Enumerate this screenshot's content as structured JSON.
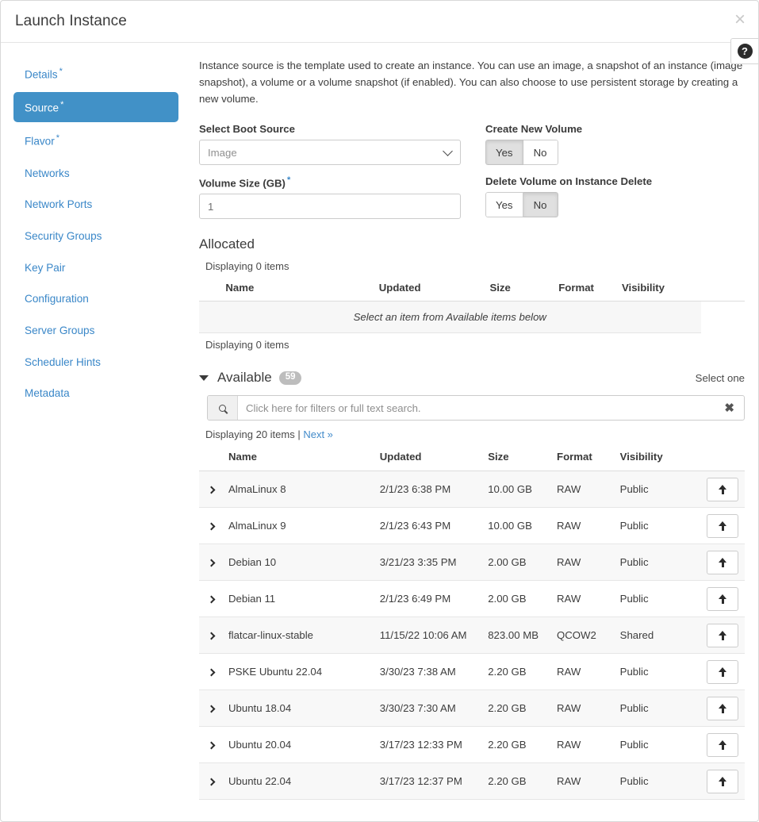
{
  "header": {
    "title": "Launch Instance",
    "close_label": "×",
    "help_label": "?"
  },
  "sidebar": {
    "items": [
      {
        "label": "Details",
        "required": true,
        "active": false
      },
      {
        "label": "Source",
        "required": true,
        "active": true
      },
      {
        "label": "Flavor",
        "required": true,
        "active": false
      },
      {
        "label": "Networks",
        "required": false,
        "active": false
      },
      {
        "label": "Network Ports",
        "required": false,
        "active": false
      },
      {
        "label": "Security Groups",
        "required": false,
        "active": false
      },
      {
        "label": "Key Pair",
        "required": false,
        "active": false
      },
      {
        "label": "Configuration",
        "required": false,
        "active": false
      },
      {
        "label": "Server Groups",
        "required": false,
        "active": false
      },
      {
        "label": "Scheduler Hints",
        "required": false,
        "active": false
      },
      {
        "label": "Metadata",
        "required": false,
        "active": false
      }
    ]
  },
  "main": {
    "description": "Instance source is the template used to create an instance. You can use an image, a snapshot of an instance (image snapshot), a volume or a volume snapshot (if enabled). You can also choose to use persistent storage by creating a new volume.",
    "boot_source": {
      "label": "Select Boot Source",
      "value": "Image"
    },
    "volume_size": {
      "label": "Volume Size (GB)",
      "value": "1",
      "required": true
    },
    "create_new_volume": {
      "label": "Create New Volume",
      "yes_label": "Yes",
      "no_label": "No",
      "selected": "Yes"
    },
    "delete_volume": {
      "label": "Delete Volume on Instance Delete",
      "yes_label": "Yes",
      "no_label": "No",
      "selected": "No"
    },
    "allocated": {
      "title": "Allocated",
      "count_top": "Displaying 0 items",
      "count_bottom": "Displaying 0 items",
      "columns": [
        "Name",
        "Updated",
        "Size",
        "Format",
        "Visibility"
      ],
      "empty_message": "Select an item from Available items below"
    },
    "available": {
      "title": "Available",
      "badge": "59",
      "select_hint": "Select one",
      "search_placeholder": "Click here for filters or full text search.",
      "search_value": "",
      "clear_label": "✖",
      "count_text": "Displaying 20 items |",
      "next_label": "Next »",
      "columns": [
        "Name",
        "Updated",
        "Size",
        "Format",
        "Visibility"
      ],
      "rows": [
        {
          "name": "AlmaLinux 8",
          "updated": "2/1/23 6:38 PM",
          "size": "10.00 GB",
          "format": "RAW",
          "visibility": "Public"
        },
        {
          "name": "AlmaLinux 9",
          "updated": "2/1/23 6:43 PM",
          "size": "10.00 GB",
          "format": "RAW",
          "visibility": "Public"
        },
        {
          "name": "Debian 10",
          "updated": "3/21/23 3:35 PM",
          "size": "2.00 GB",
          "format": "RAW",
          "visibility": "Public"
        },
        {
          "name": "Debian 11",
          "updated": "2/1/23 6:49 PM",
          "size": "2.00 GB",
          "format": "RAW",
          "visibility": "Public"
        },
        {
          "name": "flatcar-linux-stable",
          "updated": "11/15/22 10:06 AM",
          "size": "823.00 MB",
          "format": "QCOW2",
          "visibility": "Shared"
        },
        {
          "name": "PSKE Ubuntu 22.04",
          "updated": "3/30/23 7:38 AM",
          "size": "2.20 GB",
          "format": "RAW",
          "visibility": "Public"
        },
        {
          "name": "Ubuntu 18.04",
          "updated": "3/30/23 7:30 AM",
          "size": "2.20 GB",
          "format": "RAW",
          "visibility": "Public"
        },
        {
          "name": "Ubuntu 20.04",
          "updated": "3/17/23 12:33 PM",
          "size": "2.20 GB",
          "format": "RAW",
          "visibility": "Public"
        },
        {
          "name": "Ubuntu 22.04",
          "updated": "3/17/23 12:37 PM",
          "size": "2.20 GB",
          "format": "RAW",
          "visibility": "Public"
        }
      ]
    }
  },
  "colors": {
    "accent": "#4191c7",
    "link": "#3a87c8",
    "badge": "#bdbdbd",
    "row_alt": "#f8f8f8"
  }
}
